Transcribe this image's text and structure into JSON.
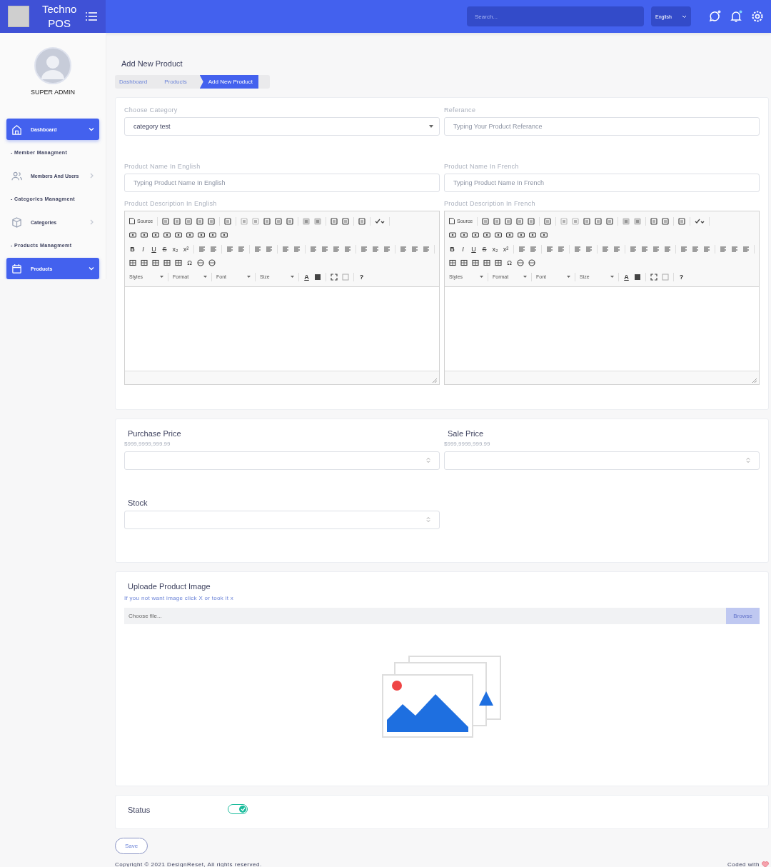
{
  "brand": {
    "line1": "Techno",
    "line2": "POS"
  },
  "topbar": {
    "search_placeholder": "Search...",
    "language": "English",
    "chat_badge": true,
    "bell_badge": true
  },
  "profile": {
    "name": "SUPER ADMIN"
  },
  "sidebar": {
    "items": [
      {
        "kind": "item",
        "label": "Dashboard",
        "selected": true,
        "expanded": true
      },
      {
        "kind": "heading",
        "label": "- Member Managment"
      },
      {
        "kind": "item",
        "label": "Members And Users",
        "selected": false,
        "expanded": false
      },
      {
        "kind": "heading",
        "label": "- Categories Managment"
      },
      {
        "kind": "item",
        "label": "Categories",
        "selected": false,
        "expanded": false
      },
      {
        "kind": "heading",
        "label": "- Products Managmemt"
      },
      {
        "kind": "item",
        "label": "Products",
        "selected": true,
        "expanded": true
      }
    ]
  },
  "page_title": "Add New Product",
  "breadcrumb": [
    {
      "label": "Dashboard",
      "selected": false
    },
    {
      "label": "Products",
      "selected": false
    },
    {
      "label": "Add New Product",
      "selected": true
    }
  ],
  "category": {
    "label": "Choose Category",
    "value": "category test"
  },
  "reference": {
    "label": "Referance",
    "placeholder": "Typing Your Product Referance"
  },
  "name_en": {
    "label": "Product Name In English",
    "placeholder": "Typing Product Name In English"
  },
  "name_fr": {
    "label": "Product Name In French",
    "placeholder": "Typing Product Name In French"
  },
  "editors": [
    {
      "label": "Product Description In English",
      "toolbar": {
        "source": "Source",
        "glyphs": [
          "B",
          "I",
          "U",
          "S",
          "x₂",
          "x²"
        ],
        "symbol": "Ω",
        "combos": [
          "Styles",
          "Format",
          "Font",
          "Size"
        ],
        "text_color": "A",
        "help": "?"
      }
    },
    {
      "label": "Product Description In French",
      "toolbar": {
        "source": "Source",
        "glyphs": [
          "B",
          "I",
          "U",
          "S",
          "x₂",
          "x²"
        ],
        "symbol": "Ω",
        "combos": [
          "Styles",
          "Format",
          "Font",
          "Size"
        ],
        "text_color": "A",
        "help": "?"
      }
    }
  ],
  "prices": [
    {
      "label": "Purchase Price",
      "hint": "$999,9999,999.99"
    },
    {
      "label": "Sale Price",
      "hint": "$999,9999,999.99"
    }
  ],
  "stock": {
    "label": "Stock"
  },
  "upload": {
    "title": "Uploade Product Image",
    "hint": "If you not want image click X or took it x",
    "placeholder": "Choose file...",
    "button": "Browse"
  },
  "status": {
    "label": "Status",
    "on": true
  },
  "save": "Save",
  "footer": {
    "copyright": "Copyright © 2021 DesignReset, All rights reserved.",
    "coded": "Coded with"
  }
}
